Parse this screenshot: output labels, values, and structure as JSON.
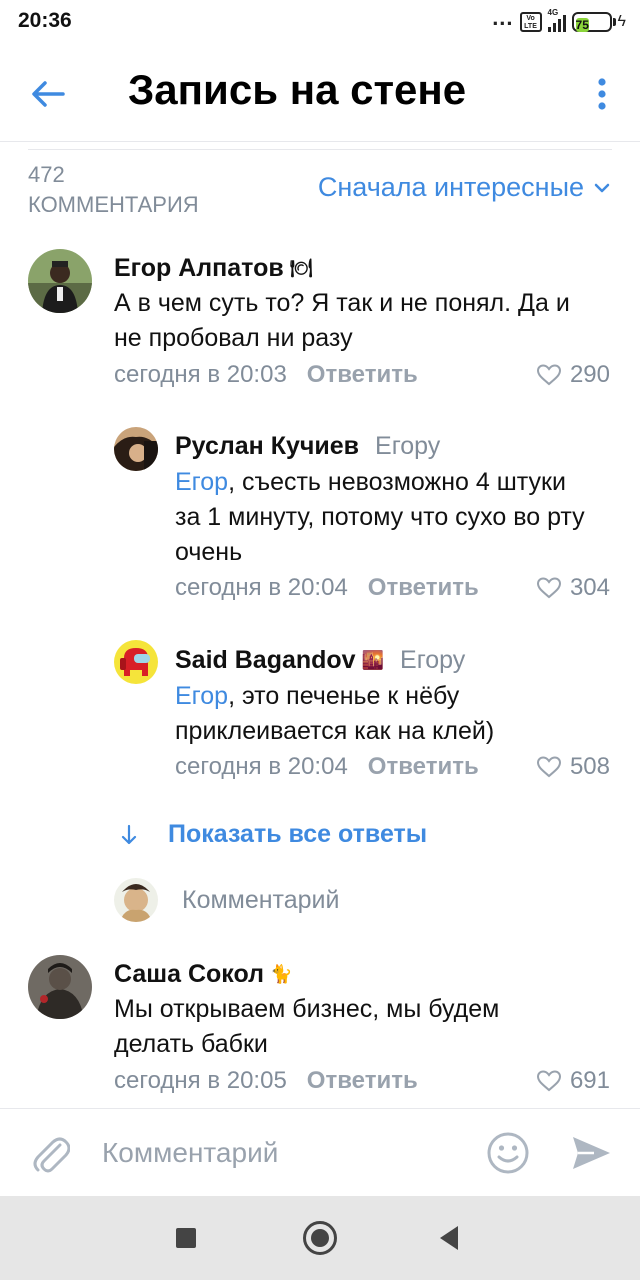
{
  "status_bar": {
    "time": "20:36",
    "dots": "...",
    "volte": "Vo LTE",
    "network": "4G",
    "battery": "75"
  },
  "header": {
    "title": "Запись на стене",
    "back_icon": "arrow-left-icon",
    "menu_icon": "more-vertical-icon"
  },
  "comments_header": {
    "count": "472",
    "count_label": "КОММЕНТАРИЯ",
    "sort_label": "Сначала интересные"
  },
  "comments": [
    {
      "author": "Егор Алпатов",
      "author_emoji": "🍽",
      "text_lines": [
        "А в чем суть то? Я так и не понял. Да и",
        "не пробовал ни разу"
      ],
      "time": "сегодня в 20:03",
      "reply_label": "Ответить",
      "likes": "290"
    },
    {
      "author": "Руслан Кучиев",
      "reply_to": "Егору",
      "mention": "Егор",
      "text_lines": [
        ", съесть невозможно 4 штуки",
        "за 1 минуту, потому что сухо во рту",
        "очень"
      ],
      "time": "сегодня в 20:04",
      "reply_label": "Ответить",
      "likes": "304"
    },
    {
      "author": "Said Bagandov",
      "author_emoji": "🌇",
      "reply_to": "Егору",
      "mention": "Егор",
      "text_lines": [
        ", это печенье к нёбу",
        "приклеивается как на клей)"
      ],
      "time": "сегодня в 20:04",
      "reply_label": "Ответить",
      "likes": "508"
    },
    {
      "author": "Саша Сокол",
      "author_emoji": "🐈",
      "text_lines": [
        "Мы открываем бизнес, мы будем",
        "делать бабки"
      ],
      "time": "сегодня в 20:05",
      "reply_label": "Ответить",
      "likes": "691"
    }
  ],
  "show_all_replies": "Показать все ответы",
  "inline_comment_placeholder": "Комментарий",
  "composer": {
    "placeholder": "Комментарий"
  },
  "colors": {
    "accent": "#3f8ae0",
    "secondary_text": "#818c99",
    "battery": "#8bd53a"
  }
}
